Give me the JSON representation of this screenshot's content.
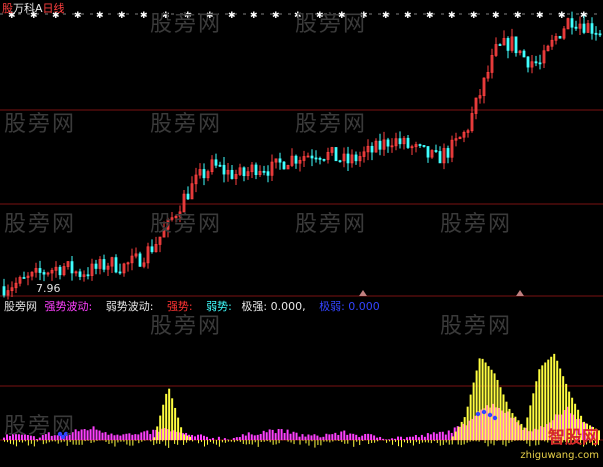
{
  "header": {
    "title_prefix": "股",
    "title": "万科A",
    "period": "日线"
  },
  "watermarks": [
    "股旁网",
    "股旁网",
    "股旁网",
    "股旁网",
    "股旁网",
    "股旁网",
    "股旁网",
    "股旁网",
    "股旁网",
    "股旁网",
    "股旁网",
    "股旁网"
  ],
  "price_panel": {
    "low_marker": "7.96"
  },
  "indicator_panel": {
    "name": "股旁网",
    "items": [
      {
        "text": "强势波动:",
        "color": "#ff40ff"
      },
      {
        "text": "弱势波动:",
        "color": "#e6e6e6"
      },
      {
        "text": "强势:",
        "color": "#ff3333"
      },
      {
        "text": "弱势:",
        "color": "#40ffff"
      },
      {
        "text": "极强: 0.000,",
        "color": "#e6e6e6"
      },
      {
        "text": "极弱: 0.000",
        "color": "#3344ff"
      }
    ]
  },
  "logo": {
    "name": "智股网",
    "url": "zhiguwang.com"
  },
  "colors": {
    "up": "#ff4040",
    "down": "#40ffff",
    "strong": "#ff40ff",
    "weak": "#ffff40",
    "extreme_weak": "#3344ff"
  },
  "chart_data": [
    {
      "type": "line",
      "name": "price_candles",
      "y_range_estimate": [
        7.96,
        16.0
      ],
      "series": [
        {
          "name": "",
          "values": [
            8.0,
            8.1,
            8.3,
            8.5,
            8.6,
            8.4,
            8.5,
            8.7,
            8.6,
            8.8,
            9.2,
            9.8,
            10.6,
            11.2,
            11.6,
            11.4,
            11.3,
            11.6,
            11.5,
            11.8,
            11.9,
            12.0,
            11.9,
            11.7,
            11.9,
            12.1,
            12.4,
            12.2,
            12.0,
            11.8,
            12.1,
            12.6,
            13.8,
            15.0,
            15.3,
            14.8,
            14.6,
            15.4,
            16.0,
            15.8,
            15.6
          ]
        }
      ]
    },
    {
      "type": "bar",
      "name": "indicator_histogram",
      "series": [
        {
          "name": "强势波动",
          "values": [
            0.3,
            0.4,
            0.2,
            0.5,
            0.3,
            0.8,
            1.0,
            0.6,
            0.5,
            0.4,
            0.7,
            0.9,
            0.5,
            0.3,
            0.2,
            0.1,
            0.3,
            0.6,
            0.8,
            0.7,
            0.4,
            0.3,
            0.5,
            0.6,
            0.4,
            0.3,
            0.2,
            0.2,
            0.3,
            0.5,
            0.7,
            1.2,
            2.5,
            3.0,
            2.2,
            1.0,
            0.8,
            1.8,
            2.6,
            1.4,
            0.6
          ]
        },
        {
          "name": "弱势波动",
          "values": [
            0,
            0,
            0,
            0,
            0,
            0,
            0,
            0,
            0,
            0,
            0,
            4.5,
            0.5,
            0,
            0,
            0,
            0,
            0,
            0,
            0,
            0,
            0,
            0,
            0,
            0,
            0,
            0,
            0,
            0,
            0,
            0,
            2.0,
            7.0,
            5.5,
            2.5,
            1.0,
            6.0,
            7.2,
            4.0,
            1.5,
            0.8
          ]
        }
      ]
    }
  ]
}
